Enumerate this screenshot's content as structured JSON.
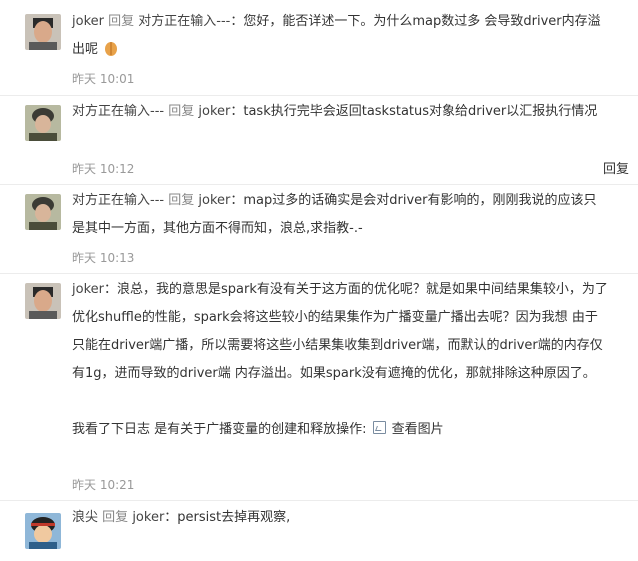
{
  "comments": [
    {
      "author": "joker",
      "reply_word": "回复",
      "reply_to": "对方正在输入---",
      "text": "：您好，能否详述一下。为什么map数过多 会导致driver内存溢出呢",
      "emoji": "praying-hands-emoji",
      "time": "昨天 10:01"
    },
    {
      "author": "对方正在输入---",
      "reply_word": "回复",
      "reply_to": "joker",
      "text": "：task执行完毕会返回taskstatus对象给driver以汇报执行情况",
      "time": "昨天 10:12",
      "reply_button": "回复"
    },
    {
      "author": "对方正在输入---",
      "reply_word": "回复",
      "reply_to": "joker",
      "text": "：map过多的话确实是会对driver有影响的，刚刚我说的应该只是其中一方面，其他方面不得而知，浪总,求指教-.-",
      "time": "昨天 10:13"
    },
    {
      "author": "joker",
      "text": "：浪总，我的意思是spark有没有关于这方面的优化呢？就是如果中间结果集较小，为了优化shuffle的性能，spark会将这些较小的结果集作为广播变量广播出去呢？因为我想 由于只能在driver端广播，所以需要将这些小结果集收集到driver端，而默认的driver端的内存仅有1g，进而导致的driver端 内存溢出。如果spark没有遮掩的优化，那就排除这种原因了。",
      "text2": "我看了下日志 是有关于广播变量的创建和释放操作:",
      "image_link": "查看图片",
      "time": "昨天 10:21"
    },
    {
      "author": "浪尖",
      "reply_word": "回复",
      "reply_to": "joker",
      "text": "：persist去掉再观察,"
    }
  ],
  "colors": {
    "divider": "#ececec",
    "time": "#999999",
    "text": "#333333"
  }
}
